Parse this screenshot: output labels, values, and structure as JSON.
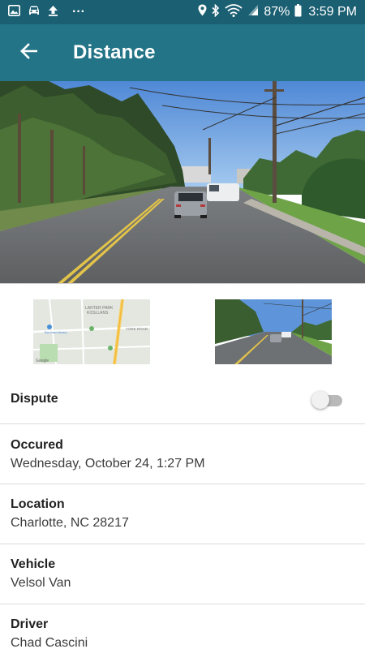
{
  "status_bar": {
    "battery_percent": "87%",
    "time": "3:59 PM",
    "more": "···",
    "left_icons": [
      "image-icon",
      "car-icon",
      "upload-icon"
    ],
    "right_icons": [
      "location-pin-icon",
      "bluetooth-icon",
      "wifi-icon",
      "signal-icon",
      "battery-icon"
    ]
  },
  "app_bar": {
    "title": "Distance",
    "back_icon": "arrow-back-icon",
    "color": "#237487"
  },
  "map_thumb": {
    "area_label": "LANTER PARK\nKOSLLANS",
    "road_label": "YORK ROAD",
    "library_label": "Bar-bard library"
  },
  "details": {
    "dispute": {
      "label": "Dispute",
      "enabled": false
    },
    "occurred": {
      "label": "Occured",
      "value": "Wednesday, October 24, 1:27 PM"
    },
    "location": {
      "label": "Location",
      "value": "Charlotte, NC 28217"
    },
    "vehicle": {
      "label": "Vehicle",
      "value": "Velsol Van"
    },
    "driver": {
      "label": "Driver",
      "value": "Chad Cascini"
    }
  },
  "colors": {
    "status_bar": "#1b5f72",
    "app_bar": "#237487",
    "divider": "#dcdcdc"
  }
}
